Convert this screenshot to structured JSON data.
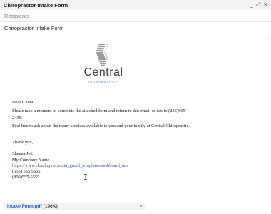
{
  "window": {
    "title": "Chiropractor Intake Form",
    "controls": {
      "minimize": "_",
      "popout": "⤢",
      "close": "✕"
    }
  },
  "compose": {
    "recipients_placeholder": "Recipients",
    "subject": "Chiropractor Intake Form"
  },
  "logo": {
    "word": "Central",
    "subtitle": "CHIROPRACTIC"
  },
  "body": {
    "greeting": "Dear Client,",
    "para1_line1": "Please take a moment to complete the attached form and return to this email or fax to (213)665-",
    "para1_line2": "2435.",
    "para2": "Feel free to ask about the many services available to you and your family at Central Chiropractic.",
    "closing": "Thank you,",
    "signature": {
      "name": "Sheena Jett",
      "company": "My Company Name",
      "url": "https://www.cloudhq.net/main_gmail_templates/dashboard_tao",
      "phone1": "(555) 555 5555",
      "phone2": "(800)555-5555"
    }
  },
  "attachment": {
    "name": "Intake Form.pdf",
    "size": "(196K)",
    "close": "×"
  },
  "colors": {
    "link": "#3657a6",
    "attachment_name": "#1a56b8",
    "logo_accent": "#6a8fb0"
  }
}
